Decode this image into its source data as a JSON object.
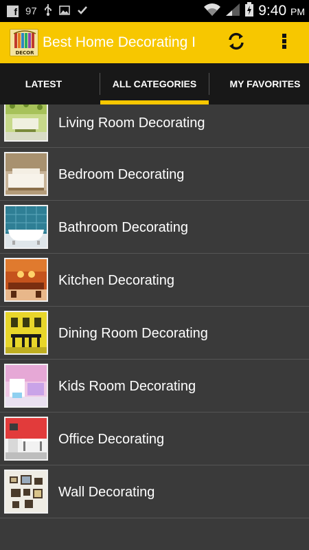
{
  "status_bar": {
    "notification_count": "97",
    "time": "9:40",
    "ampm": "PM"
  },
  "action_bar": {
    "icon_label": "DECOR",
    "title": "Best Home Decorating I",
    "accent_color": "#f7c700"
  },
  "tabs": [
    {
      "label": "LATEST"
    },
    {
      "label": "ALL CATEGORIES"
    },
    {
      "label": "MY FAVORITES"
    }
  ],
  "categories": [
    {
      "label": "Living Room Decorating"
    },
    {
      "label": "Bedroom Decorating"
    },
    {
      "label": "Bathroom Decorating"
    },
    {
      "label": "Kitchen Decorating"
    },
    {
      "label": "Dining Room Decorating"
    },
    {
      "label": "Kids Room Decorating"
    },
    {
      "label": "Office Decorating"
    },
    {
      "label": "Wall Decorating"
    }
  ]
}
